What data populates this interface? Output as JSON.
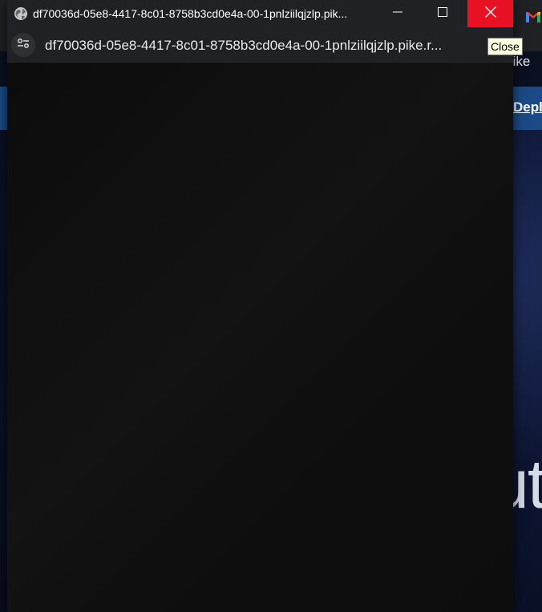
{
  "popup": {
    "title": "df70036d-05e8-4417-8c01-8758b3cd0e4a-00-1pnlziilqjzlp.pik...",
    "url": "df70036d-05e8-4417-8c01-8758b3cd0e4a-00-1pnlziilqjzlp.pike.r...",
    "icons": {
      "site": "globe-icon",
      "site_info": "site-settings-icon",
      "minimize": "minimize-icon",
      "maximize": "maximize-icon",
      "close": "close-icon"
    },
    "close_color": "#e81123"
  },
  "tooltip": {
    "text": "Close"
  },
  "background_window": {
    "url_fragment": "o.pike",
    "nav_link": "Depl",
    "hero_text": "ut",
    "nav_color": "#1c4a86"
  }
}
